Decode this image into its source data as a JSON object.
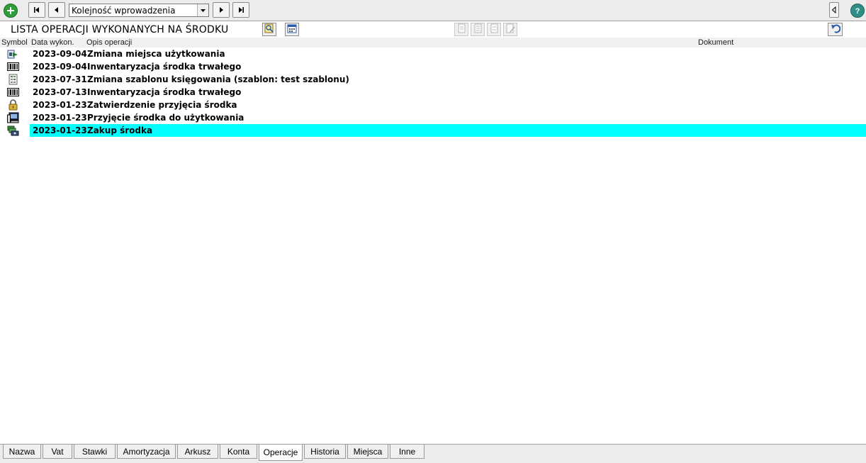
{
  "toolbar": {
    "add_icon": "plus-circle-icon",
    "first_icon": "first-record-icon",
    "prev_icon": "previous-record-icon",
    "order_select": {
      "value": "Kolejność wprowadzenia"
    },
    "next_icon": "next-record-icon",
    "last_icon": "last-record-icon",
    "collapse_icon": "collapse-left-icon",
    "help_icon": "help-icon"
  },
  "panel": {
    "title": "LISTA OPERACJI WYKONANYCH NA ŚRODKU",
    "preview_icon": "preview-icon",
    "calendar_icon": "calendar-icon",
    "undo_icon": "undo-icon"
  },
  "columns": {
    "symbol": "Symbol",
    "date": "Data wykon.",
    "description": "Opis operacji",
    "document": "Dokument"
  },
  "rows": [
    {
      "icon": "location-change-icon",
      "date": "2023-09-04",
      "description": "Zmiana miejsca użytkowania"
    },
    {
      "icon": "barcode-icon",
      "date": "2023-09-04",
      "description": "Inwentaryzacja środka trwałego"
    },
    {
      "icon": "template-icon",
      "date": "2023-07-31",
      "description": "Zmiana szablonu księgowania (szablon: test szablonu)"
    },
    {
      "icon": "barcode-icon",
      "date": "2023-07-13",
      "description": "Inwentaryzacja środka trwałego"
    },
    {
      "icon": "lock-icon",
      "date": "2023-01-23",
      "description": "Zatwierdzenie przyjęcia środka"
    },
    {
      "icon": "computer-icon",
      "date": "2023-01-23",
      "description": "Przyjęcie środka do użytkowania"
    },
    {
      "icon": "purchase-icon",
      "date": "2023-01-23",
      "description": "Zakup środka",
      "selected": true
    }
  ],
  "tabs": [
    {
      "label": "Nazwa"
    },
    {
      "label": "Vat"
    },
    {
      "label": "Stawki"
    },
    {
      "label": "Amortyzacja"
    },
    {
      "label": "Arkusz"
    },
    {
      "label": "Konta"
    },
    {
      "label": "Operacje",
      "active": true
    },
    {
      "label": "Historia"
    },
    {
      "label": "Miejsca"
    },
    {
      "label": "Inne"
    }
  ],
  "colors": {
    "selection": "#00ffff",
    "add_icon": "#2e9e3a",
    "help_icon": "#2f8f86"
  }
}
